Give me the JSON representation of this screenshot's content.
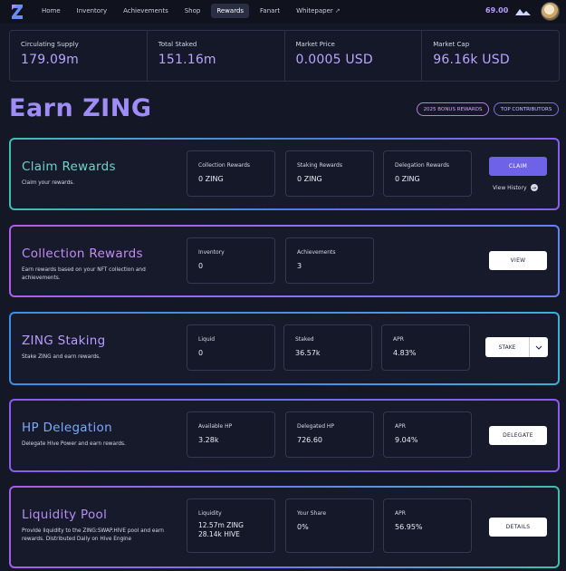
{
  "nav": {
    "items": [
      {
        "label": "Home"
      },
      {
        "label": "Inventory"
      },
      {
        "label": "Achievements"
      },
      {
        "label": "Shop"
      },
      {
        "label": "Rewards"
      },
      {
        "label": "Fanart"
      },
      {
        "label": "Whitepaper"
      }
    ],
    "active": "Rewards",
    "balance": "69.00",
    "icons": {
      "logo": "zing-logo",
      "external": "external-link-icon",
      "currency": "hive-icon",
      "avatar": "user-avatar"
    }
  },
  "stats": [
    {
      "label": "Circulating Supply",
      "value": "179.09m"
    },
    {
      "label": "Total Staked",
      "value": "151.16m"
    },
    {
      "label": "Market Price",
      "value": "0.0005 USD"
    },
    {
      "label": "Market Cap",
      "value": "96.16k USD"
    }
  ],
  "page": {
    "title": "Earn ZING",
    "bonus_label": "2025 BONUS REWARDS",
    "top_label": "TOP CONTRIBUTORS"
  },
  "claim": {
    "title": "Claim Rewards",
    "desc": "Claim your rewards.",
    "boxes": [
      {
        "label": "Collection Rewards",
        "value": "0 ZING"
      },
      {
        "label": "Staking Rewards",
        "value": "0 ZING"
      },
      {
        "label": "Delegation Rewards",
        "value": "0 ZING"
      }
    ],
    "button": "CLAIM",
    "history": "View History"
  },
  "collection": {
    "title": "Collection Rewards",
    "desc": "Earn rewards based on your NFT collection and achievements.",
    "boxes": [
      {
        "label": "Inventory",
        "value": "0"
      },
      {
        "label": "Achievements",
        "value": "3"
      }
    ],
    "button": "VIEW"
  },
  "staking": {
    "title": "ZING Staking",
    "desc": "Stake ZING and earn rewards.",
    "boxes": [
      {
        "label": "Liquid",
        "value": "0"
      },
      {
        "label": "Staked",
        "value": "36.57k"
      },
      {
        "label": "APR",
        "value": "4.83%"
      }
    ],
    "button": "STAKE"
  },
  "delegation": {
    "title": "HP Delegation",
    "desc": "Delegate Hive Power and earn rewards.",
    "boxes": [
      {
        "label": "Available HP",
        "value": "3.28k"
      },
      {
        "label": "Delegated HP",
        "value": "726.60"
      },
      {
        "label": "APR",
        "value": "9.04%"
      }
    ],
    "button": "DELEGATE"
  },
  "liquidity": {
    "title": "Liquidity Pool",
    "desc": "Provide liquidity to the ZING:SWAP.HIVE pool and earn rewards. Distributed Daily on Hive Engine",
    "boxes": [
      {
        "label": "Liquidity",
        "value": "12.57m ZING",
        "value2": "28.14k HIVE"
      },
      {
        "label": "Your Share",
        "value": "0%"
      },
      {
        "label": "APR",
        "value": "56.95%"
      }
    ],
    "button": "DETAILS"
  }
}
